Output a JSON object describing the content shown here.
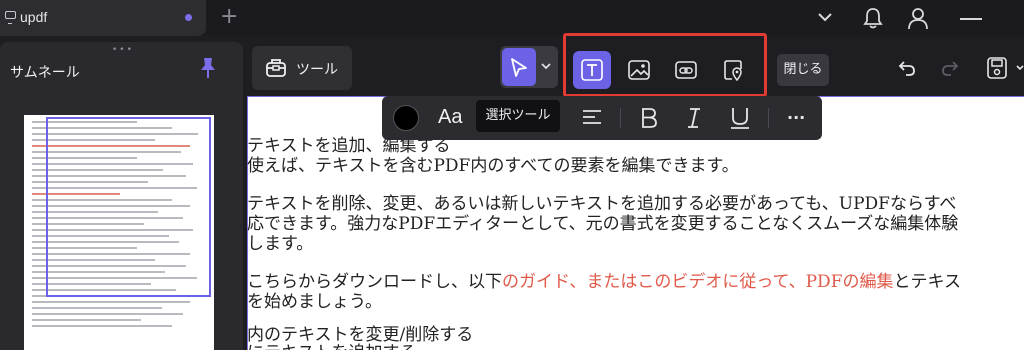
{
  "titlebar": {
    "tab_title": "updf",
    "new_tab": "+"
  },
  "left_panel": {
    "grip": "•••",
    "title": "サムネール"
  },
  "toolbar": {
    "tools_label": "ツール",
    "close_label": "閉じる"
  },
  "format_bar": {
    "font_label": "Aa",
    "tooltip": "選択ツール",
    "more": "···"
  },
  "document": {
    "lines": [
      {
        "text": "テキストを追加、編集する"
      },
      {
        "text": "使えば、テキストを含むPDF内のすべての要素を編集できます。"
      },
      {
        "text": "テキストを削除、変更、あるいは新しいテキストを追加する必要があっても、UPDFならすべ"
      },
      {
        "text": "応できます。強力なPDFエディターとして、元の書式を変更することなくスムーズな編集体験"
      },
      {
        "text": "します。"
      },
      {
        "text_pre": "こちらからダウンロードし、以下",
        "text_link": "のガイド、またはこのビデオに従って、PDFの編集",
        "text_post": "とテキス"
      },
      {
        "text": "を始めましょう。"
      },
      {
        "text": "内のテキストを変更/削除する"
      },
      {
        "text": "にテキストを追加する"
      }
    ]
  },
  "colors": {
    "accent": "#6b62e6",
    "highlight_border": "#e23b33",
    "link_red": "#e05a4a"
  },
  "icons": [
    "monitor-icon",
    "chevron-down-icon",
    "bell-icon",
    "user-icon",
    "minimize-icon",
    "pin-icon",
    "toolbox-icon",
    "cursor-icon",
    "text-icon",
    "image-icon",
    "link-icon",
    "geo-icon",
    "undo-icon",
    "redo-icon",
    "save-icon",
    "align-icon",
    "bold-icon",
    "italic-icon",
    "underline-icon"
  ]
}
